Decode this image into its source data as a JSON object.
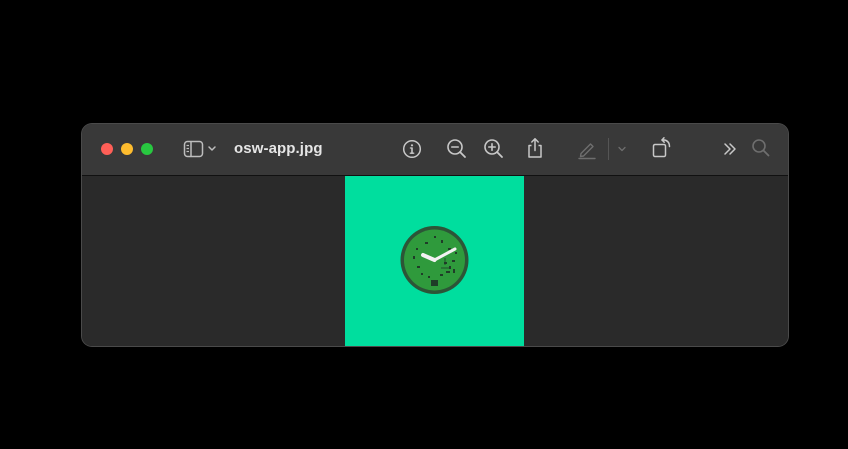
{
  "window": {
    "title": "osw-app.jpg"
  },
  "toolbar": {
    "sidebar_toggle_icon": "sidebar-icon",
    "info_icon": "info-icon",
    "zoom_out_icon": "zoom-out-icon",
    "zoom_in_icon": "zoom-in-icon",
    "share_icon": "share-icon",
    "markup_icon": "pen-icon",
    "rotate_icon": "rotate-icon",
    "more_icon": "chevron-double-right-icon",
    "search_icon": "search-icon"
  },
  "colors": {
    "close": "#ff5f57",
    "minimize": "#febc2e",
    "zoom": "#28c840",
    "titlebar": "#393939",
    "canvas": "#2a2a2a",
    "image_background": "#00de9e",
    "clock_face": "#2f9a3c"
  },
  "image": {
    "subject": "watch-face-icon"
  }
}
